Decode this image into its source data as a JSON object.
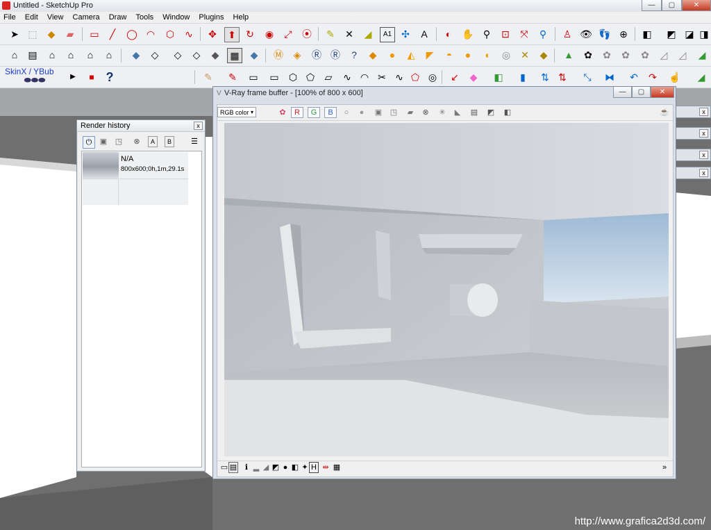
{
  "app": {
    "title": "Untitled - SketchUp Pro"
  },
  "window_controls": {
    "minimize": "—",
    "maximize": "▢",
    "close": "✕"
  },
  "menu": [
    "File",
    "Edit",
    "View",
    "Camera",
    "Draw",
    "Tools",
    "Window",
    "Plugins",
    "Help"
  ],
  "toolbar_row1": [
    "select",
    "component",
    "paint-bucket",
    "eraser",
    "rectangle",
    "line",
    "circle",
    "arc",
    "polygon",
    "freehand",
    "move",
    "push-pull",
    "rotate",
    "follow-me",
    "scale",
    "offset",
    "tape-measure",
    "dimension",
    "protractor",
    "text",
    "axes",
    "3d-text",
    "orbit",
    "pan",
    "zoom",
    "zoom-window",
    "zoom-extents",
    "previous",
    "position-camera",
    "look-around",
    "walk",
    "section-plane"
  ],
  "toolbar_row2": [
    "iso-view",
    "top-view",
    "front-view",
    "right-view",
    "back-view",
    "left-view",
    "x-ray",
    "wireframe",
    "hidden-line",
    "shaded",
    "shaded-textures",
    "monochrome",
    "vray-material-editor",
    "vray-options",
    "vray-render",
    "vray-rt-render",
    "vray-help",
    "vray-texture",
    "vray-omni-light",
    "vray-spot-light",
    "vray-rect-light",
    "vray-sphere-light",
    "vray-dome-light",
    "vray-ies-light",
    "vray-sun",
    "vray-infinite-plane",
    "vray-proxy",
    "sandbox-from-contours",
    "sandbox-from-scratch",
    "sandbox-smoove",
    "sandbox-stamp",
    "sandbox-drape",
    "sandbox-add-detail",
    "sandbox-flip-edge",
    "outliner"
  ],
  "toolbar_row3": {
    "skin_label": "SkinX / YBub",
    "tools": [
      "play",
      "stop",
      "help",
      "paintbrush",
      "pencil",
      "bezier-curve",
      "rect-2",
      "hexagon",
      "pentagon",
      "parallelogram",
      "spline",
      "curve",
      "knife",
      "lasso",
      "ring",
      "arrow-red",
      "eraser-pink",
      "cube-face",
      "push-blue",
      "arrows-up",
      "arrows-red",
      "diagonal-arrow",
      "split",
      "undo-arc",
      "redo-arc",
      "hand-pointer",
      "book-green"
    ]
  },
  "render_history": {
    "title": "Render history",
    "close": "x",
    "toolbar": [
      "power",
      "save",
      "save-as",
      "delete",
      "A",
      "B",
      "menu"
    ],
    "entries": [
      {
        "name": "N/A",
        "details": "800x600;0h,1m,29.1s"
      }
    ]
  },
  "frame_buffer": {
    "title": "V-Ray frame buffer - [100% of 800 x 600]",
    "channel": "RGB color",
    "channels": [
      "R",
      "G",
      "B"
    ],
    "window_controls": {
      "minimize": "—",
      "maximize": "▢",
      "close": "✕"
    },
    "status_icons": [
      "frame",
      "film",
      "info",
      "histogram",
      "levels",
      "curve",
      "circle",
      "ab",
      "pin",
      "H",
      "split",
      "grid"
    ],
    "expand": "»"
  },
  "watermark": "http://www.grafica2d3d.com/",
  "colors": {
    "titlebar": "#e6e9ee",
    "accent_close": "#c43a22",
    "viewport": "#6f6f6f"
  }
}
